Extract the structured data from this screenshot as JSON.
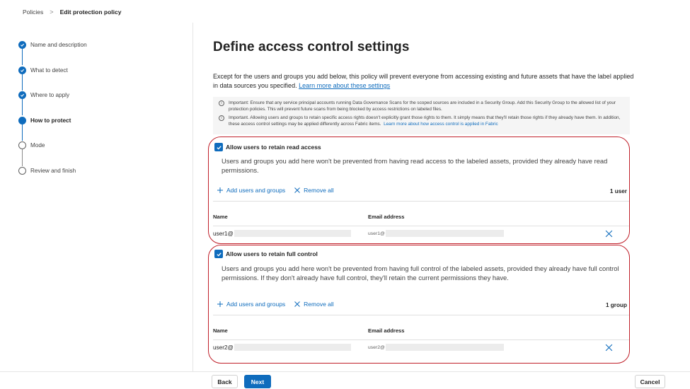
{
  "breadcrumb": {
    "parent": "Policies",
    "separator": ">",
    "current": "Edit protection policy"
  },
  "steps": [
    {
      "label": "Name and description",
      "state": "done"
    },
    {
      "label": "What to detect",
      "state": "done"
    },
    {
      "label": "Where to apply",
      "state": "done"
    },
    {
      "label": "How to protect",
      "state": "current"
    },
    {
      "label": "Mode",
      "state": "pending"
    },
    {
      "label": "Review and finish",
      "state": "pending"
    }
  ],
  "main": {
    "title": "Define access control settings",
    "intro": "Except for the users and groups you add below, this policy will prevent everyone from accessing existing and future assets that have the label applied in data sources you specified.",
    "intro_link": "Learn more about these settings"
  },
  "notice": {
    "icon": "info-icon",
    "line1": "Important: Ensure that any service principal accounts running Data Governance Scans for the scoped sources are included in a Security Group. Add this Security Group to the allowed list of your protection policies. This will prevent future scans from being blocked by access restrictions on labeled files.",
    "line2": "Important. Allowing users and groups to retain specific access rights doesn't explicitly grant those rights to them. It simply means that they'll retain those rights if they already have them. In addition, these access control settings may be applied differently across Fabric items.",
    "line2_link": "Learn more about how access control is applied in Fabric"
  },
  "read_section": {
    "checkbox_label": "Allow users to retain read access",
    "checked": true,
    "description": "Users and groups you add here won't be prevented from having read access to the labeled assets, provided they already have read permissions.",
    "add_label": "Add users and groups",
    "remove_label": "Remove all",
    "count": "1 user",
    "col_name": "Name",
    "col_email": "Email address",
    "rows": [
      {
        "name": "user1@",
        "email": "user1@"
      }
    ]
  },
  "full_section": {
    "checkbox_label": "Allow users to retain full control",
    "checked": true,
    "description": "Users and groups you add here won't be prevented from having full control of the labeled assets, provided they already have full control permissions. If they don't already have full control, they'll retain the current permissions they have.",
    "add_label": "Add users and groups",
    "remove_label": "Remove all",
    "count": "1 group",
    "col_name": "Name",
    "col_email": "Email address",
    "rows": [
      {
        "name": "user2@",
        "email": "user2@"
      }
    ]
  },
  "footer": {
    "back_label": "Back",
    "next_label": "Next",
    "cancel_label": "Cancel"
  },
  "colors": {
    "accent": "#0f6cbd",
    "highlight": "#c0202a"
  }
}
